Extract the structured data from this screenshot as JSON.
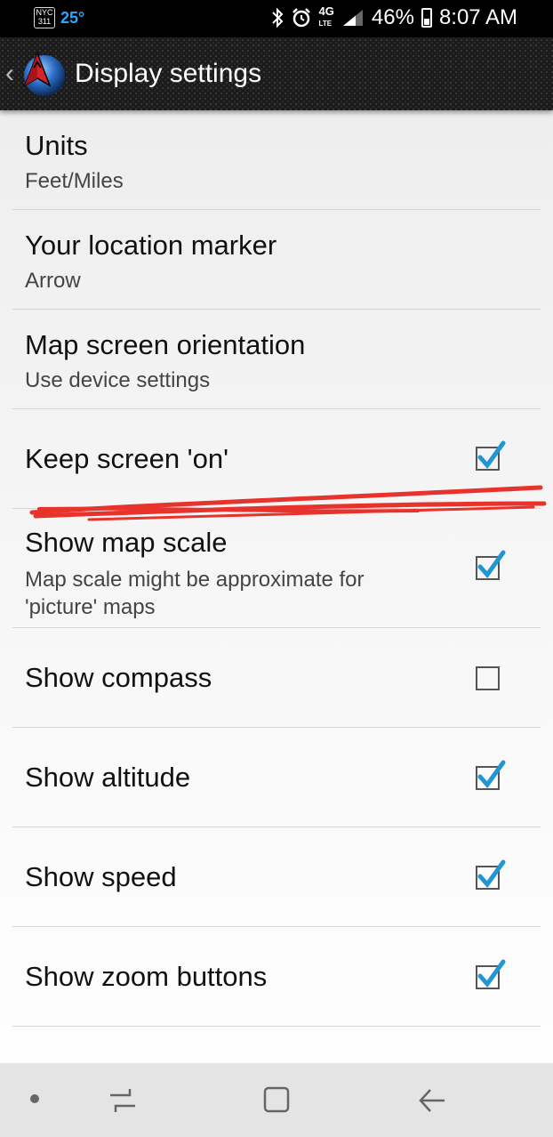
{
  "status_bar": {
    "badge_top": "NYC",
    "badge_bottom": "311",
    "temperature": "25°",
    "network": "4G",
    "network_sub": "LTE",
    "battery": "46%",
    "battery_level": 0.46,
    "time": "8:07 AM"
  },
  "app_bar": {
    "title": "Display settings"
  },
  "settings": [
    {
      "title": "Units",
      "subtitle": "Feet/Miles"
    },
    {
      "title": "Your location marker",
      "subtitle": "Arrow"
    },
    {
      "title": "Map screen orientation",
      "subtitle": "Use device settings"
    },
    {
      "title": "Keep screen 'on'",
      "checked": true
    },
    {
      "title": "Show map scale",
      "subtitle": "Map scale might be approximate for 'picture' maps",
      "checked": true
    },
    {
      "title": "Show compass",
      "checked": false
    },
    {
      "title": "Show altitude",
      "checked": true
    },
    {
      "title": "Show speed",
      "checked": true
    },
    {
      "title": "Show zoom buttons",
      "checked": true
    }
  ],
  "colors": {
    "check_color": "#2196d3",
    "annotation_red": "#e8322c"
  }
}
